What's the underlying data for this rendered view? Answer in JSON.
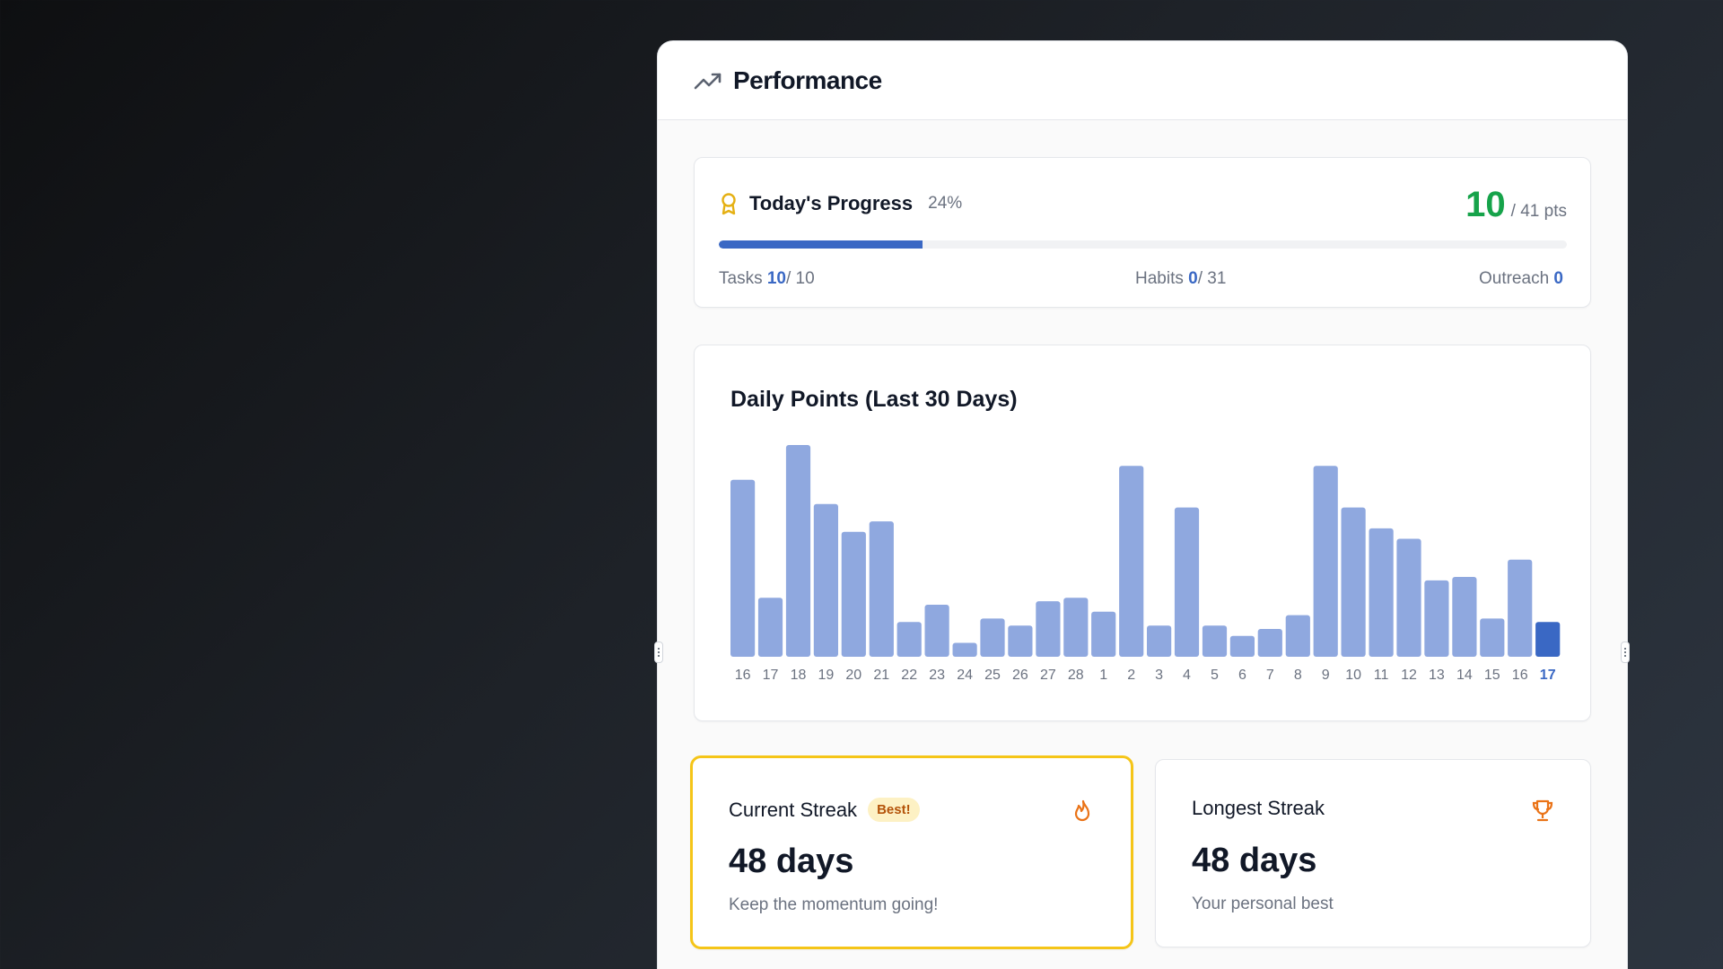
{
  "header": {
    "title": "Performance",
    "icon": "trending-up-icon"
  },
  "progress": {
    "title": "Today's Progress",
    "icon": "award-icon",
    "percent_label": "24%",
    "percent": 24,
    "points_value": "10",
    "points_total": "/ 41 pts",
    "tasks": {
      "label": "Tasks",
      "value": "10",
      "total": "/ 10"
    },
    "habits": {
      "label": "Habits",
      "value": "0",
      "total": "/ 31"
    },
    "outreach": {
      "label": "Outreach",
      "value": "0"
    }
  },
  "chart": {
    "title": "Daily Points (Last 30 Days)"
  },
  "chart_data": {
    "type": "bar",
    "title": "Daily Points (Last 30 Days)",
    "categories": [
      "16",
      "17",
      "18",
      "19",
      "20",
      "21",
      "22",
      "23",
      "24",
      "25",
      "26",
      "27",
      "28",
      "1",
      "2",
      "3",
      "4",
      "5",
      "6",
      "7",
      "8",
      "9",
      "10",
      "11",
      "12",
      "13",
      "14",
      "15",
      "16",
      "17"
    ],
    "values": [
      51,
      17,
      61,
      44,
      36,
      39,
      10,
      15,
      4,
      11,
      9,
      16,
      17,
      13,
      55,
      9,
      43,
      9,
      6,
      8,
      12,
      55,
      43,
      37,
      34,
      22,
      23,
      11,
      28,
      10
    ],
    "highlight_index": 29,
    "ylim": [
      0,
      61
    ],
    "grid": false,
    "colors": {
      "bar": "#8fa8df",
      "highlight": "#3a68c4",
      "label": "#6b7280"
    }
  },
  "streaks": {
    "current": {
      "label": "Current Streak",
      "badge": "Best!",
      "icon": "flame-icon",
      "value": "48 days",
      "subtitle": "Keep the momentum going!"
    },
    "longest": {
      "label": "Longest Streak",
      "icon": "trophy-icon",
      "value": "48 days",
      "subtitle": "Your personal best"
    }
  },
  "colors": {
    "accent": "#3a68c4",
    "points_green": "#16a34a",
    "highlight_border": "#f5c518",
    "icon_orange": "#ea7317",
    "icon_gold": "#e5b013"
  }
}
